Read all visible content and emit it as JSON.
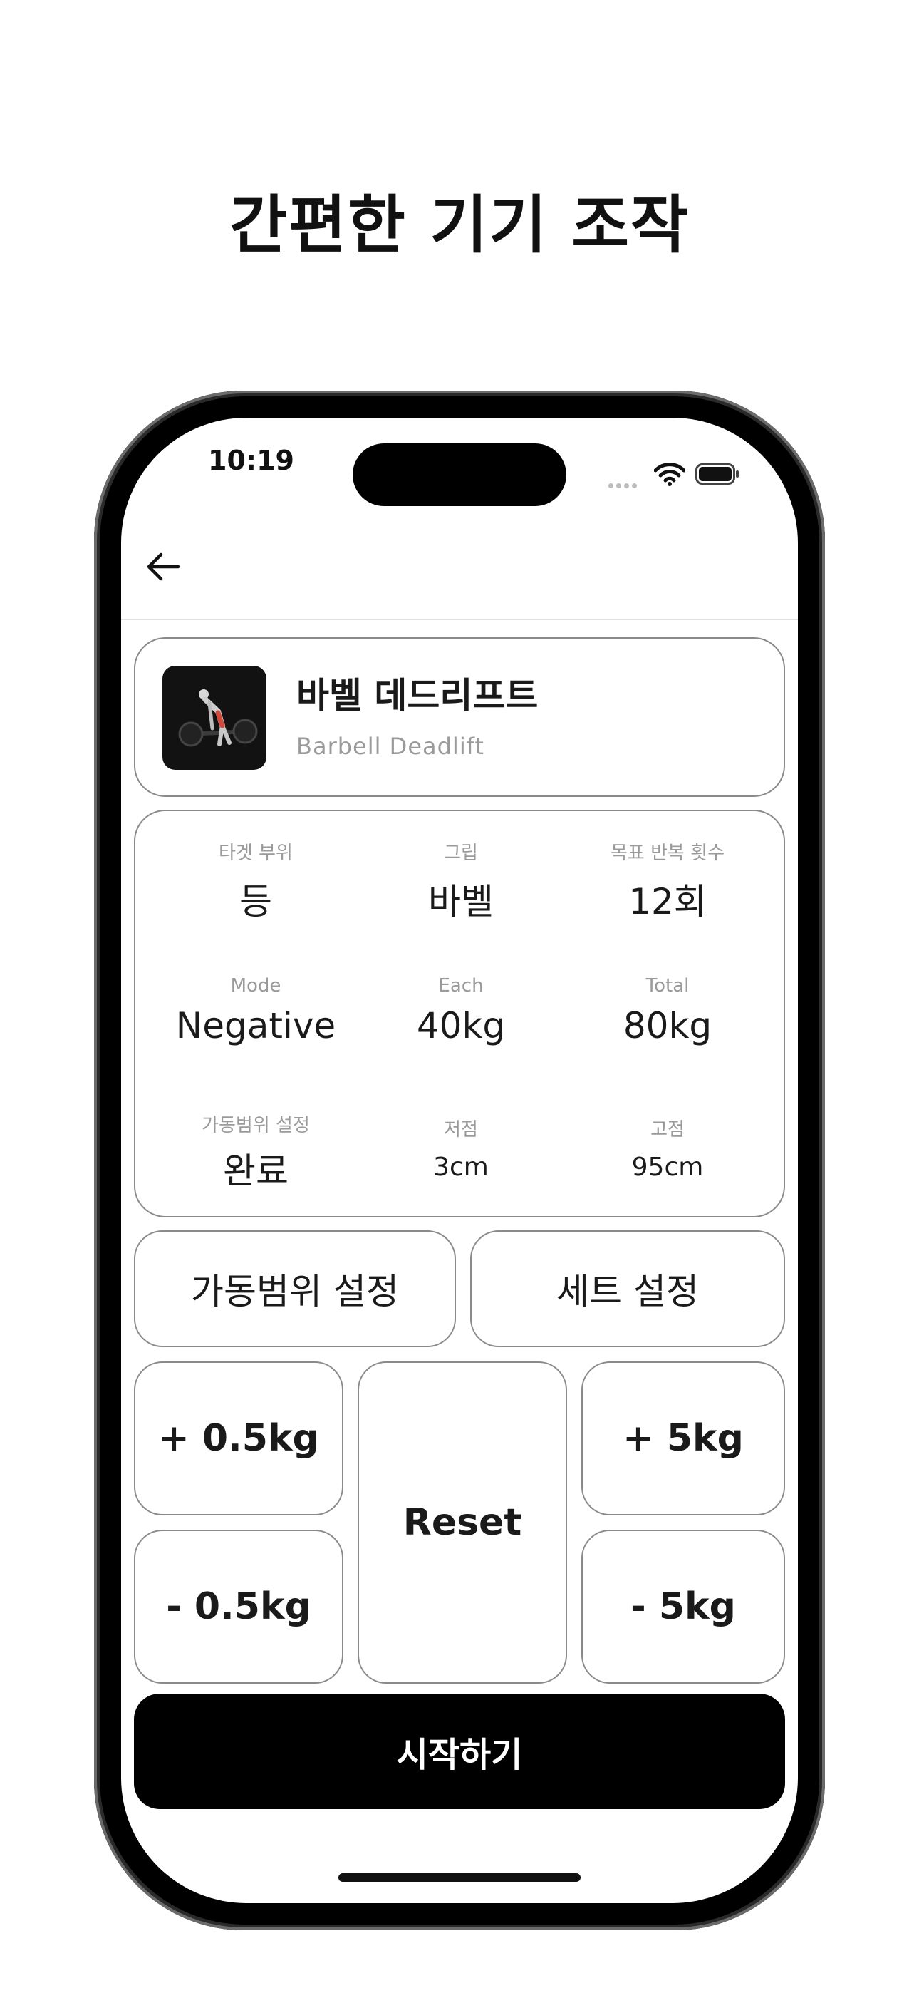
{
  "headline": "간편한 기기 조작",
  "status_bar": {
    "time": "10:19"
  },
  "exercise": {
    "name_ko": "바벨 데드리프트",
    "name_en": "Barbell Deadlift"
  },
  "info": {
    "target_label": "타겟 부위",
    "target_value": "등",
    "grip_label": "그립",
    "grip_value": "바벨",
    "reps_label": "목표 반복 횟수",
    "reps_value": "12회",
    "mode_label": "Mode",
    "mode_value": "Negative",
    "each_label": "Each",
    "each_value": "40kg",
    "total_label": "Total",
    "total_value": "80kg",
    "rom_label": "가동범위 설정",
    "rom_value": "완료",
    "low_label": "저점",
    "low_value": "3cm",
    "high_label": "고점",
    "high_value": "95cm"
  },
  "buttons": {
    "rom_setting": "가동범위 설정",
    "set_setting": "세트 설정",
    "plus_half": "+ 0.5kg",
    "minus_half": "- 0.5kg",
    "reset": "Reset",
    "plus_five": "+ 5kg",
    "minus_five": "- 5kg",
    "start": "시작하기"
  },
  "icons": {
    "back": "arrow-left-icon",
    "wifi": "wifi-icon",
    "battery": "battery-icon",
    "signal": "signal-dots-icon"
  },
  "colors": {
    "primary": "#000000",
    "border": "#8a8a8a",
    "muted": "#9a9a9a"
  }
}
